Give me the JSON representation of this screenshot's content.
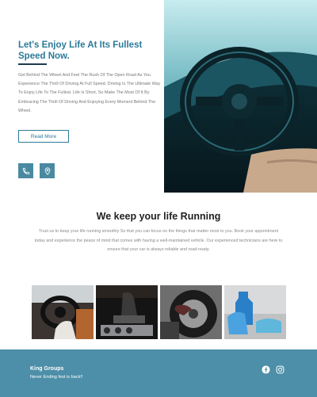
{
  "hero": {
    "title": "Let's Enjoy Life At Its Fullest Speed Now.",
    "text": "Get Behind The Wheel And Feel The Rush Of The Open Road As You Experience The Thrill Of Driving At Full Speed. Driving Is The Ultimate Way To Enjoy Life To The Fullest. Life Is Short, So Make The Most Of It By Embracing The Thrill Of Driving And Enjoying Every Moment Behind The Wheel.",
    "read_more_label": "Read More",
    "buttons": [
      {
        "icon": "phone-icon"
      },
      {
        "icon": "location-pin-icon"
      }
    ]
  },
  "about": {
    "title": "We keep your life Running",
    "text": "Trust us to keep your life running smoothly So that you can focus on the things that matter most to you. Book your appointment today and experience the peace of mind that comes with having a well-maintained vehicle. Our experienced technicians are here to ensure that your car is always reliable and road-ready."
  },
  "gallery": {
    "images": [
      {
        "name": "driver-at-wheel"
      },
      {
        "name": "gear-shifter"
      },
      {
        "name": "tire-service"
      },
      {
        "name": "car-cleaning"
      }
    ]
  },
  "footer": {
    "brand": "King Groups",
    "tagline": "Never Ending fest is back!!",
    "social": [
      "facebook-icon",
      "instagram-icon"
    ]
  },
  "colors": {
    "accent": "#2c7a98",
    "footer_bg": "#4d8fa8",
    "icon_button_bg": "#4a8aa0"
  }
}
